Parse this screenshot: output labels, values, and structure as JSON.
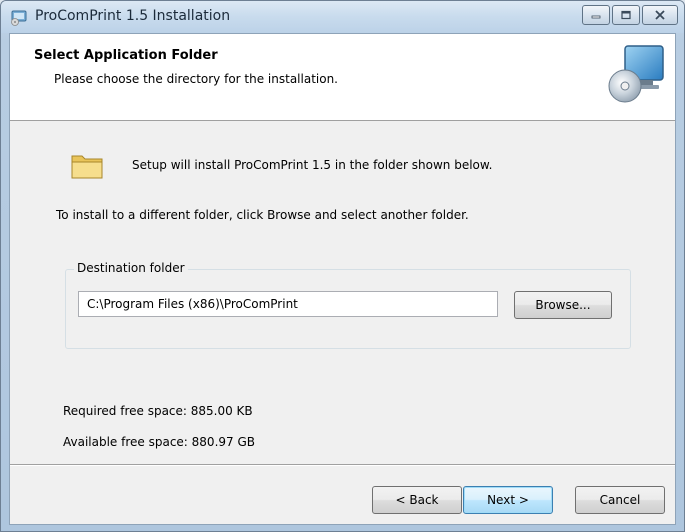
{
  "window": {
    "title": "ProComPrint 1.5 Installation",
    "controls": {
      "minimize_icon": "minimize-icon",
      "maximize_icon": "maximize-icon",
      "close_icon": "close-icon"
    }
  },
  "header": {
    "title": "Select Application Folder",
    "subtitle": "Please choose the directory for the installation.",
    "graphic_icon": "computer-disc-icon"
  },
  "body": {
    "intro": "Setup will install ProComPrint 1.5 in the folder shown below.",
    "instruction": "To install to a different folder, click Browse and select another folder.",
    "folder_icon": "folder-icon",
    "destination": {
      "legend": "Destination folder",
      "path": "C:\\Program Files (x86)\\ProComPrint",
      "browse_label": "Browse..."
    },
    "required_space": "Required free space: 885.00 KB",
    "available_space": "Available free space: 880.97 GB"
  },
  "footer": {
    "back_label": "< Back",
    "next_label": "Next >",
    "cancel_label": "Cancel"
  },
  "colors": {
    "default_button_border": "#3c7fb1",
    "window_frame": "#b8cde2",
    "client_bg": "#f0f0f0"
  }
}
